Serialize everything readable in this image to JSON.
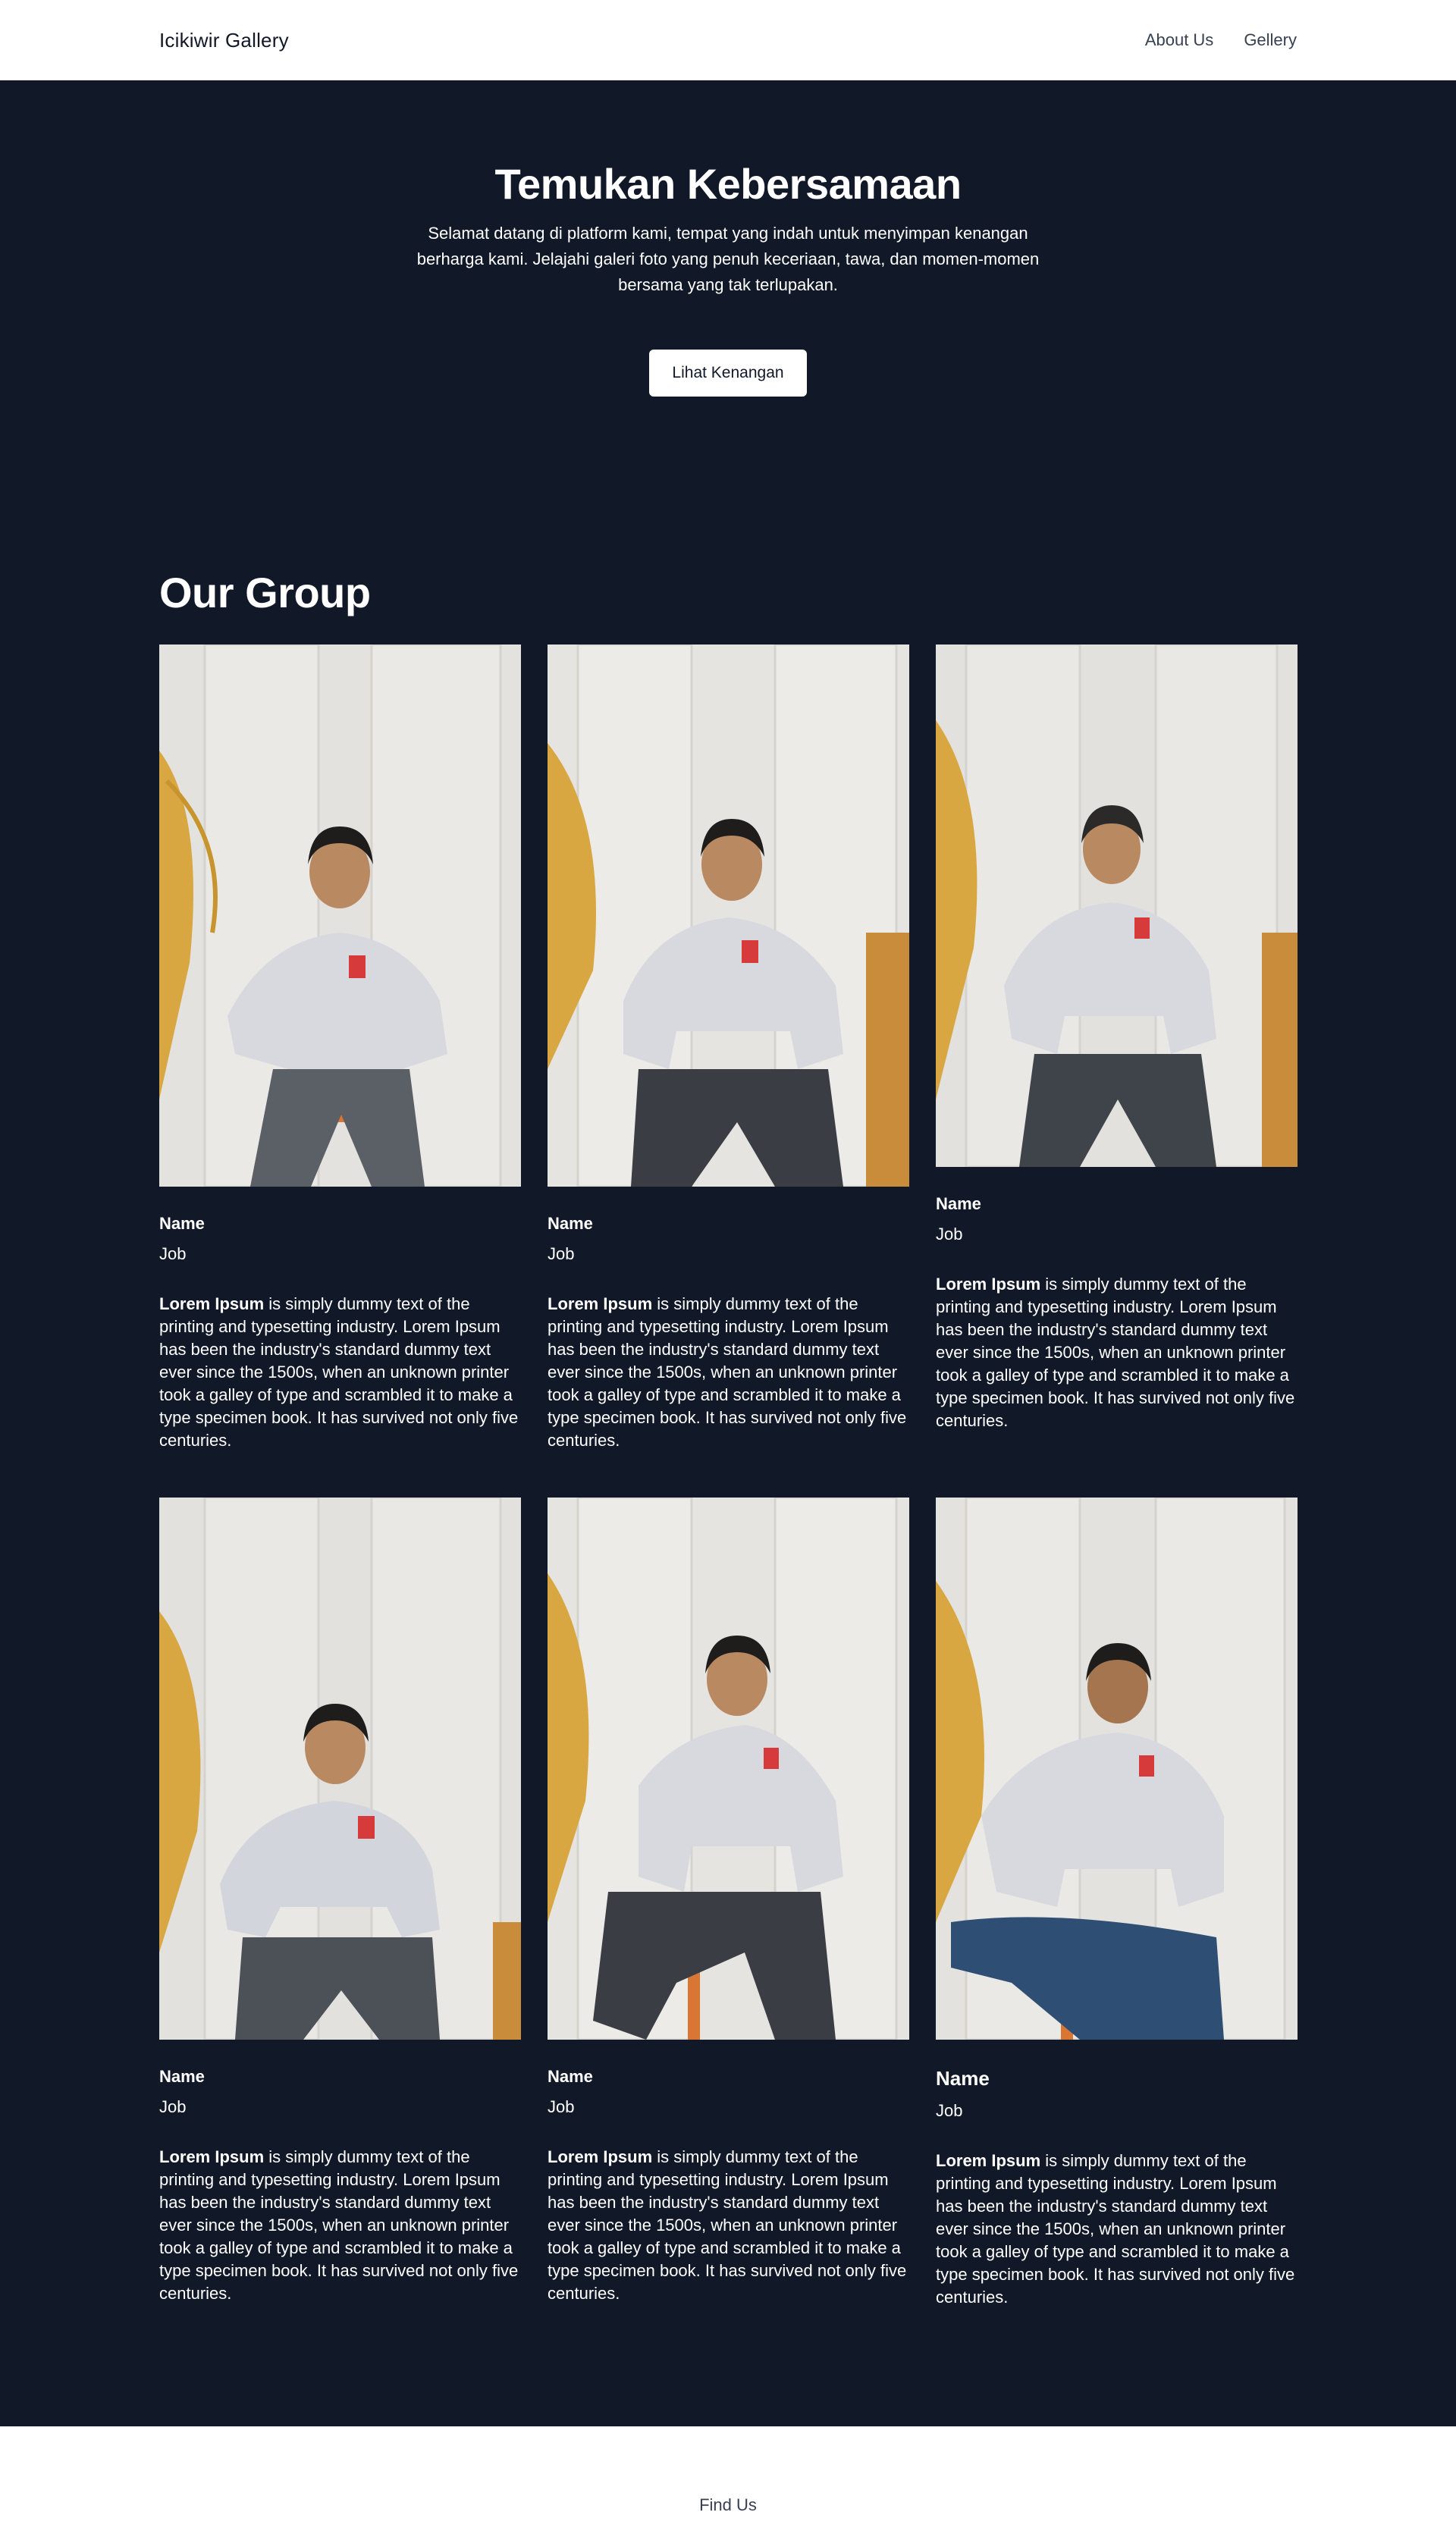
{
  "nav": {
    "brand": "Icikiwir Gallery",
    "links": [
      "About Us",
      "Gellery"
    ]
  },
  "hero": {
    "title": "Temukan Kebersamaan",
    "lead": "Selamat datang di platform kami, tempat yang indah untuk menyimpan kenangan berharga kami. Jelajahi galeri foto yang penuh keceriaan, tawa, dan momen-momen bersama yang tak terlupakan.",
    "button": "Lihat Kenangan"
  },
  "group": {
    "title": "Our Group",
    "members": [
      {
        "name": "Name",
        "job": "Job",
        "desc_bold": "Lorem Ipsum",
        "desc": " is simply dummy text of the printing and typesetting industry. Lorem Ipsum has been the industry's standard dummy text ever since the 1500s, when an unknown printer took a galley of type and scrambled it to make a type specimen book. It has survived not only five centuries."
      },
      {
        "name": "Name",
        "job": "Job",
        "desc_bold": "Lorem Ipsum",
        "desc": " is simply dummy text of the printing and typesetting industry. Lorem Ipsum has been the industry's standard dummy text ever since the 1500s, when an unknown printer took a galley of type and scrambled it to make a type specimen book. It has survived not only five centuries."
      },
      {
        "name": "Name",
        "job": "Job",
        "desc_bold": "Lorem Ipsum",
        "desc": " is simply dummy text of the printing and typesetting industry. Lorem Ipsum has been the industry's standard dummy text ever since the 1500s, when an unknown printer took a galley of type and scrambled it to make a type specimen book. It has survived not only five centuries."
      },
      {
        "name": "Name",
        "job": "Job",
        "desc_bold": "Lorem Ipsum",
        "desc": " is simply dummy text of the printing and typesetting industry. Lorem Ipsum has been the industry's standard dummy text ever since the 1500s, when an unknown printer took a galley of type and scrambled it to make a type specimen book. It has survived not only five centuries."
      },
      {
        "name": "Name",
        "job": "Job",
        "desc_bold": "Lorem Ipsum",
        "desc": " is simply dummy text of the printing and typesetting industry. Lorem Ipsum has been the industry's standard dummy text ever since the 1500s, when an unknown printer took a galley of type and scrambled it to make a type specimen book. It has survived not only five centuries."
      },
      {
        "name": "Name",
        "job": "Job",
        "desc_bold": "Lorem Ipsum",
        "desc": " is simply dummy text of the printing and typesetting industry. Lorem Ipsum has been the industry's standard dummy text ever since the 1500s, when an unknown printer took a galley of type and scrambled it to make a type specimen book. It has survived not only five centuries."
      }
    ]
  },
  "footer": {
    "link": "Find Us"
  },
  "colors": {
    "dark_bg": "#111827",
    "white": "#ffffff",
    "muted_text": "#374151"
  }
}
